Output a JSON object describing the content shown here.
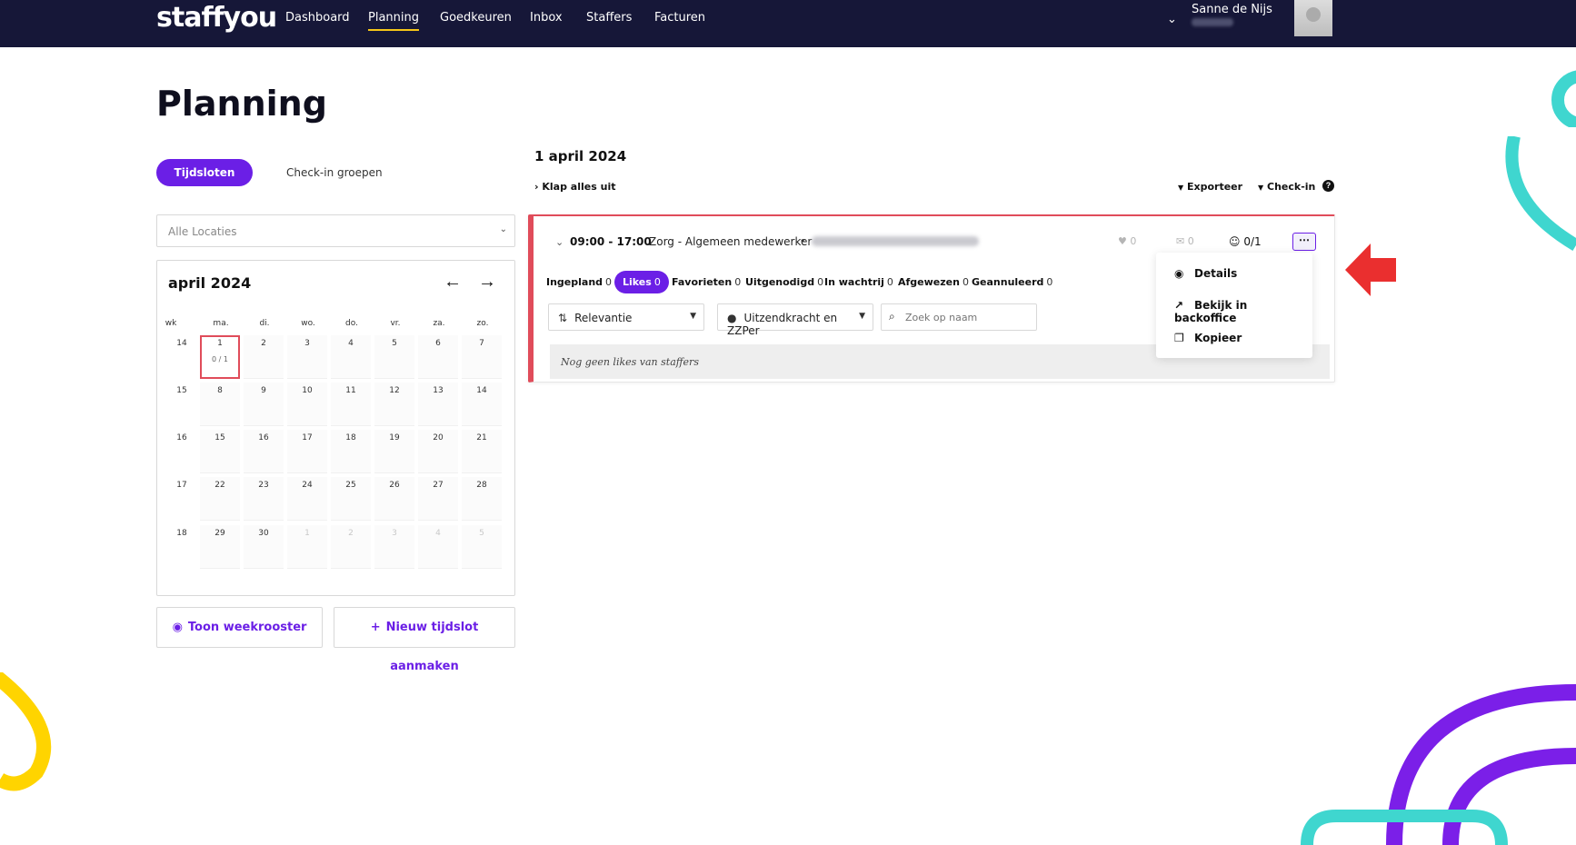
{
  "brand": "staffyou",
  "nav": {
    "items": [
      "Dashboard",
      "Planning",
      "Goedkeuren",
      "Inbox",
      "Staffers",
      "Facturen"
    ],
    "active": "Planning"
  },
  "user": {
    "name": "Sanne de Nijs"
  },
  "page": {
    "title": "Planning"
  },
  "tabs": {
    "active": "Tijdsloten",
    "other": "Check-in groepen"
  },
  "location_select": {
    "value": "Alle Locaties"
  },
  "calendar": {
    "month": "april 2024",
    "headers": [
      "wk",
      "ma.",
      "di.",
      "wo.",
      "do.",
      "vr.",
      "za.",
      "zo."
    ],
    "weeks": [
      "14",
      "15",
      "16",
      "17",
      "18"
    ],
    "rows": [
      [
        "1",
        "2",
        "3",
        "4",
        "5",
        "6",
        "7"
      ],
      [
        "8",
        "9",
        "10",
        "11",
        "12",
        "13",
        "14"
      ],
      [
        "15",
        "16",
        "17",
        "18",
        "19",
        "20",
        "21"
      ],
      [
        "22",
        "23",
        "24",
        "25",
        "26",
        "27",
        "28"
      ],
      [
        "29",
        "30",
        "1",
        "2",
        "3",
        "4",
        "5"
      ]
    ],
    "selected_count": "0 / 1"
  },
  "buttons": {
    "weekrooster": "Toon weekrooster",
    "new_slot": "Nieuw tijdslot aanmaken"
  },
  "panel": {
    "date": "1 april 2024",
    "collapse_all": "Klap alles uit",
    "export": "Exporteer",
    "checkin": "Check-in"
  },
  "slot": {
    "time": "09:00 - 17:00",
    "role": "Zorg - Algemeen medewerker",
    "likes": "0",
    "messages": "0",
    "staffed": "0/1",
    "sub_tabs": [
      {
        "label": "Ingepland",
        "count": "0"
      },
      {
        "label": "Likes",
        "count": "0"
      },
      {
        "label": "Favorieten",
        "count": "0"
      },
      {
        "label": "Uitgenodigd",
        "count": "0"
      },
      {
        "label": "In wachtrij",
        "count": "0"
      },
      {
        "label": "Afgewezen",
        "count": "0"
      },
      {
        "label": "Geannuleerd",
        "count": "0"
      }
    ],
    "sort_value": "Relevantie",
    "type_value": "Uitzendkracht en ZZPer",
    "search_placeholder": "Zoek op naam",
    "empty_text": "Nog geen likes van staffers"
  },
  "menu": {
    "items": [
      "Details",
      "Bekijk in backoffice",
      "Kopieer"
    ]
  },
  "colors": {
    "navy": "#161738",
    "purple": "#6b1fe6",
    "red": "#e04c5a",
    "teal": "#3fd6cf",
    "yellow": "#ffd400"
  }
}
